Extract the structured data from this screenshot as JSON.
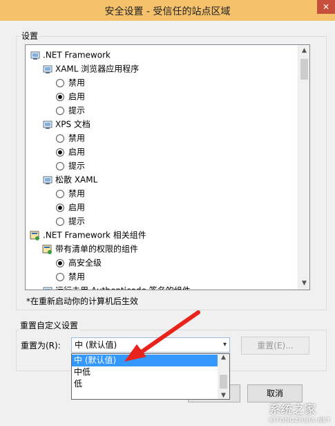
{
  "window": {
    "title": "安全设置 - 受信任的站点区域",
    "close_icon": "close-icon"
  },
  "settings_group": {
    "label": "设置"
  },
  "tree": {
    "rows": [
      {
        "type": "node",
        "icon": "settings-icon",
        "label": ".NET Framework"
      },
      {
        "type": "node",
        "icon": "settings-icon",
        "label": "XAML 浏览器应用程序"
      },
      {
        "type": "option",
        "label": "禁用",
        "checked": false
      },
      {
        "type": "option",
        "label": "启用",
        "checked": true
      },
      {
        "type": "option",
        "label": "提示",
        "checked": false
      },
      {
        "type": "node",
        "icon": "settings-icon",
        "label": "XPS 文档"
      },
      {
        "type": "option",
        "label": "禁用",
        "checked": false
      },
      {
        "type": "option",
        "label": "启用",
        "checked": true
      },
      {
        "type": "option",
        "label": "提示",
        "checked": false
      },
      {
        "type": "node",
        "icon": "settings-icon",
        "label": "松散 XAML"
      },
      {
        "type": "option",
        "label": "禁用",
        "checked": false
      },
      {
        "type": "option",
        "label": "启用",
        "checked": true
      },
      {
        "type": "option",
        "label": "提示",
        "checked": false
      },
      {
        "type": "node",
        "icon": "certificate-icon",
        "label": ".NET Framework 相关组件"
      },
      {
        "type": "node",
        "icon": "certificate-icon",
        "label": "带有清单的权限的组件"
      },
      {
        "type": "option",
        "label": "高安全级",
        "checked": true
      },
      {
        "type": "option",
        "label": "禁用",
        "checked": false
      },
      {
        "type": "node",
        "icon": "settings-icon",
        "label": "运行未用 Authenticode 签名的组件"
      }
    ]
  },
  "note": "*在重新启动你的计算机后生效",
  "reset_group": {
    "label": "重置自定义设置",
    "reset_to_label": "重置为(R):",
    "combo_value": "中 (默认值)",
    "reset_button": "重置(E)...",
    "options": [
      "中 (默认值)",
      "中低",
      "低"
    ],
    "selected_index": 0
  },
  "footer": {
    "cancel_button": "取消"
  },
  "watermark": {
    "text": "系统之家",
    "sub": "XITONGZHIJIA.NET"
  },
  "colors": {
    "title_bg": "#f5c26b",
    "selection": "#3399ff",
    "annotation_arrow": "#e8231c"
  }
}
